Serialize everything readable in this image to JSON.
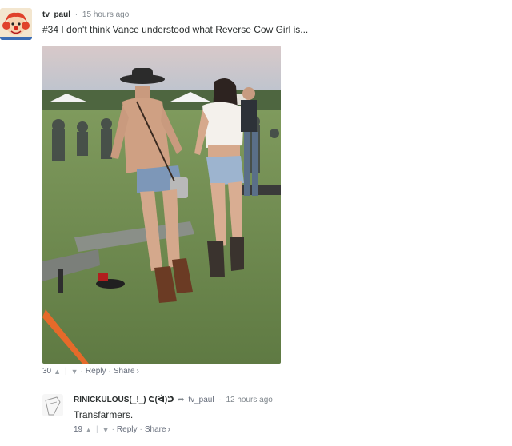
{
  "comment_1": {
    "username": "tv_paul",
    "timestamp": "15 hours ago",
    "text": "#34 I don't think Vance understood what Reverse Cow Girl is...",
    "votes": "30",
    "upvote_icon": "chevron-up-icon",
    "downvote_icon": "chevron-down-icon",
    "reply_label": "Reply",
    "share_label": "Share",
    "share_glyph": "›"
  },
  "comment_2": {
    "username": "RINICKULOUS(_!_) ᕦ(ᐛ)ᕤ",
    "reply_to_icon": "reply-arrow-icon",
    "reply_to_user": "tv_paul",
    "timestamp": "12 hours ago",
    "text": "Transfarmers.",
    "votes": "19",
    "reply_label": "Reply",
    "share_label": "Share",
    "share_glyph": "›"
  },
  "colors": {
    "text": "#2a2e2e",
    "muted": "#656c7a",
    "grass": "#6f8a4e"
  }
}
